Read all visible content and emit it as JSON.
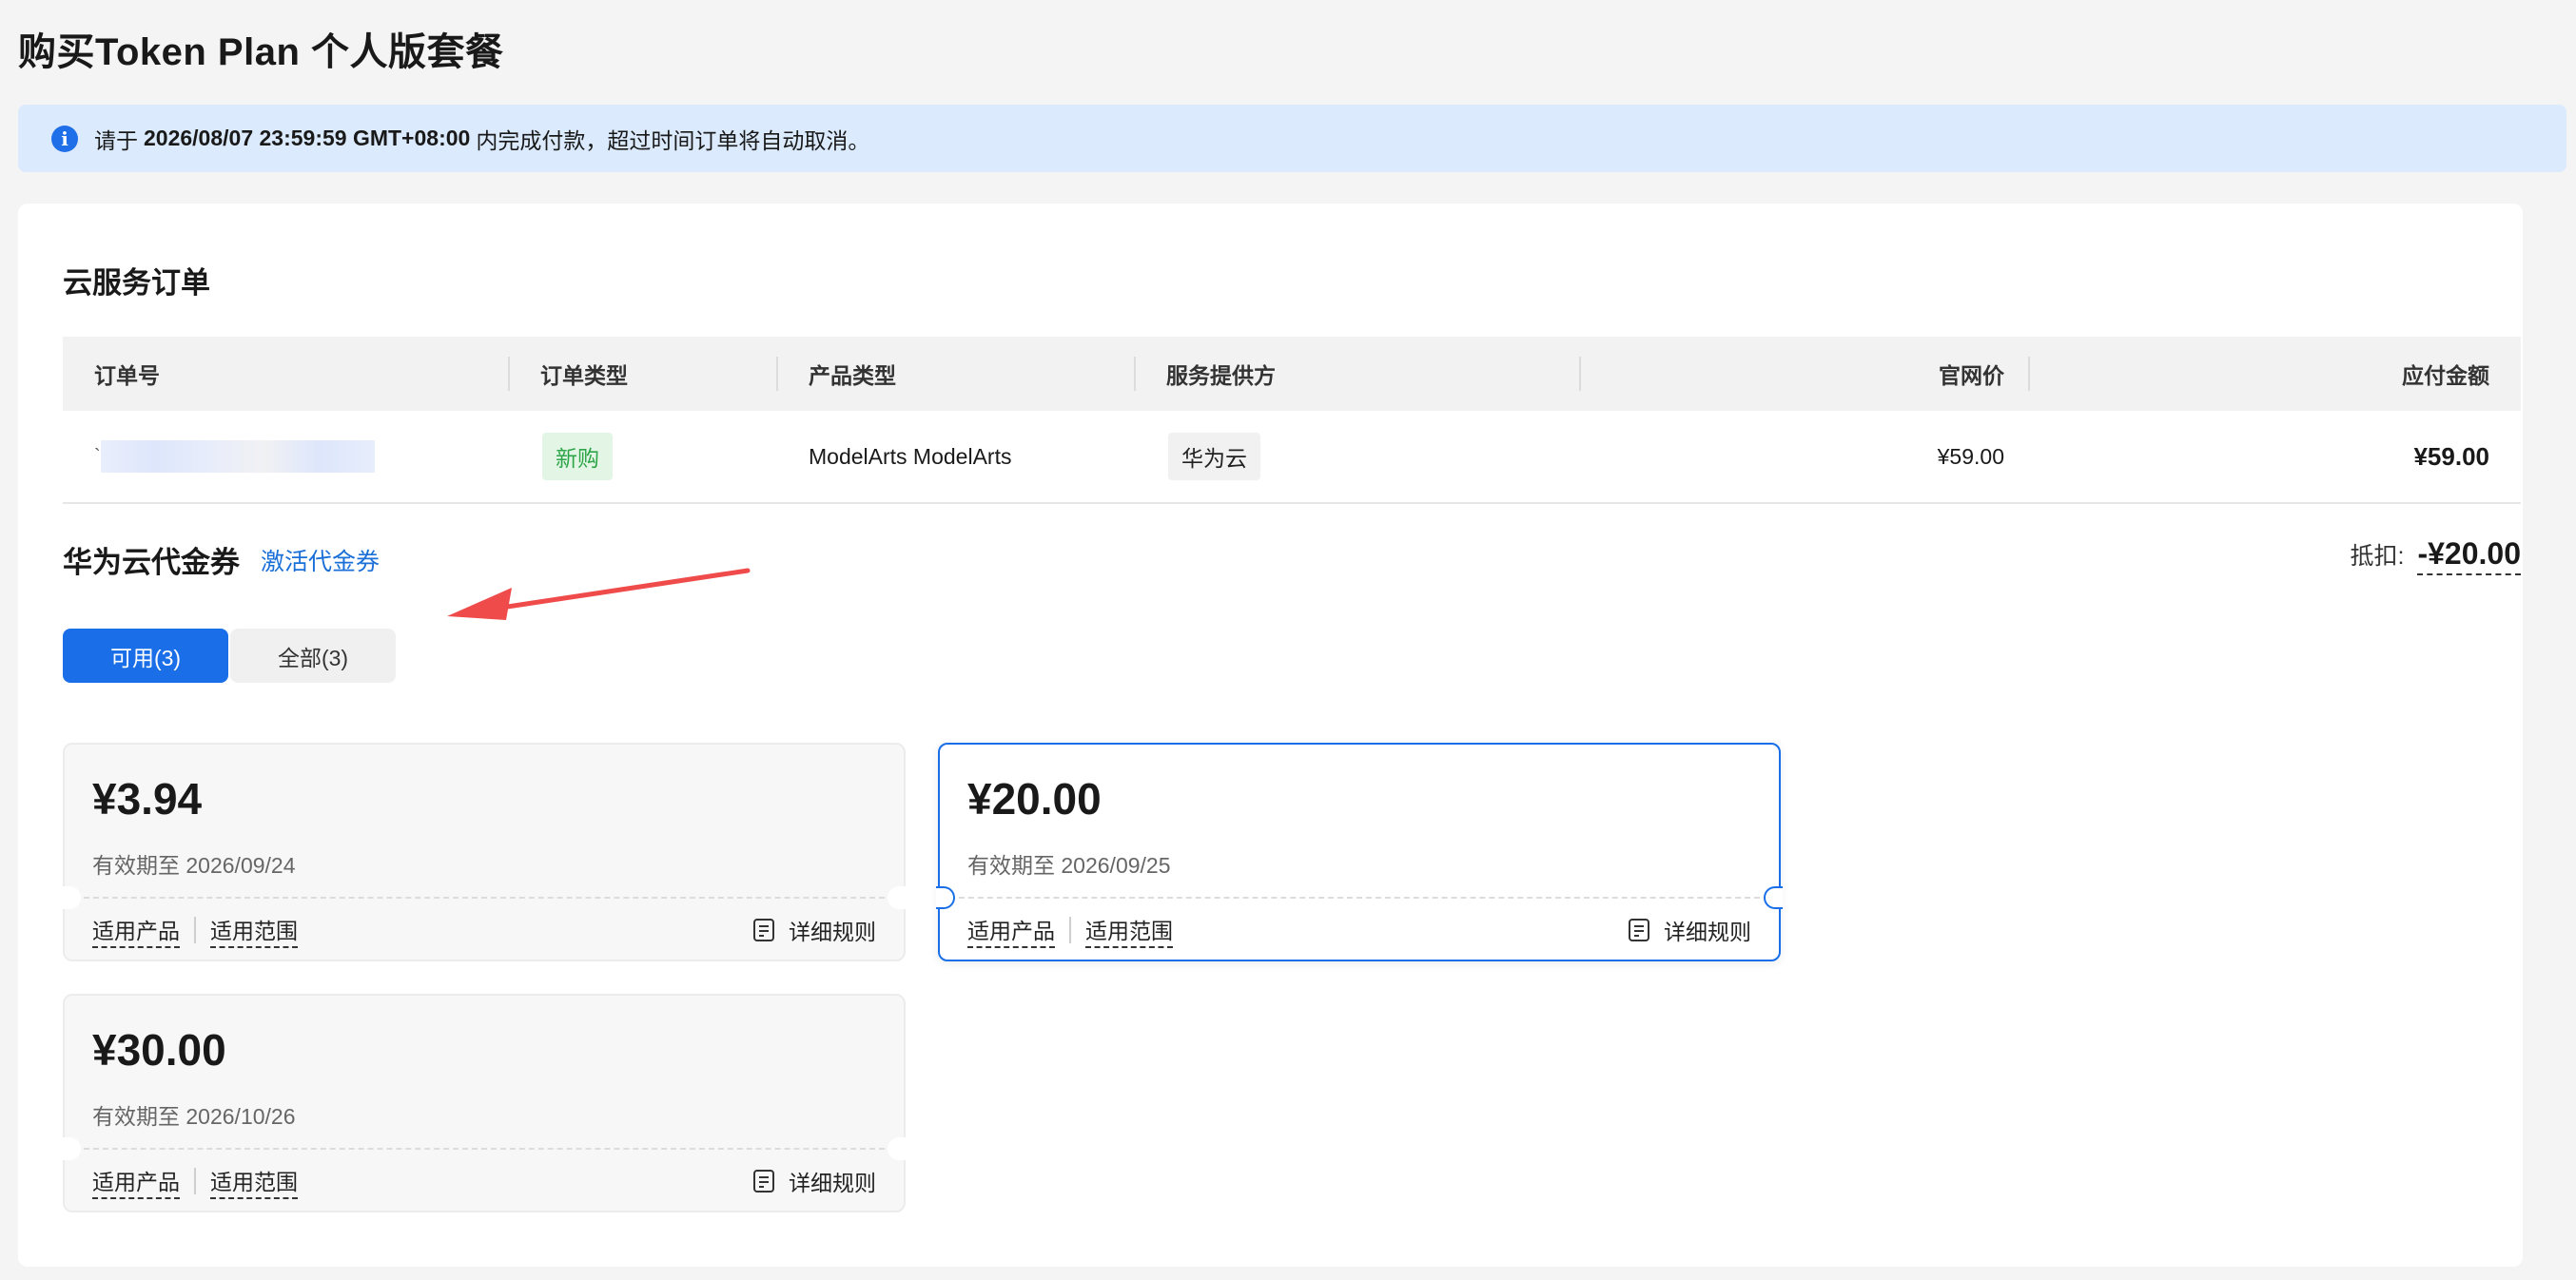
{
  "page_title": "购买Token Plan 个人版套餐",
  "notice": {
    "prefix": "请于",
    "deadline": "2026/08/07 23:59:59 GMT+08:00",
    "suffix": "内完成付款，超过时间订单将自动取消。"
  },
  "order": {
    "section_title": "云服务订单",
    "headers": {
      "order_no": "订单号",
      "order_type": "订单类型",
      "product_type": "产品类型",
      "provider": "服务提供方",
      "list_price": "官网价",
      "payable": "应付金额"
    },
    "row": {
      "order_no_prefix": "`",
      "order_type": "新购",
      "product_type": "ModelArts ModelArts",
      "provider": "华为云",
      "list_price": "¥59.00",
      "payable": "¥59.00"
    }
  },
  "vouchers": {
    "title": "华为云代金券",
    "activate_link": "激活代金券",
    "deduct_label": "抵扣:",
    "deduct_amount": "-¥20.00",
    "tabs": [
      {
        "label": "可用(3)",
        "active": true
      },
      {
        "label": "全部(3)",
        "active": false
      }
    ],
    "items": [
      {
        "amount": "¥3.94",
        "expiry": "有效期至 2026/09/24",
        "selected": false
      },
      {
        "amount": "¥20.00",
        "expiry": "有效期至 2026/09/25",
        "selected": true
      },
      {
        "amount": "¥30.00",
        "expiry": "有效期至 2026/10/26",
        "selected": false
      }
    ],
    "footer": {
      "applicable_products": "适用产品",
      "applicable_scope": "适用范围",
      "rules": "详细规则"
    }
  },
  "colors": {
    "accent": "#1a6fe8",
    "notice_bg": "#dbeafd",
    "tag_new_bg": "#e3f6e5",
    "tag_new_text": "#2ea549",
    "arrow": "#f04b4b"
  }
}
